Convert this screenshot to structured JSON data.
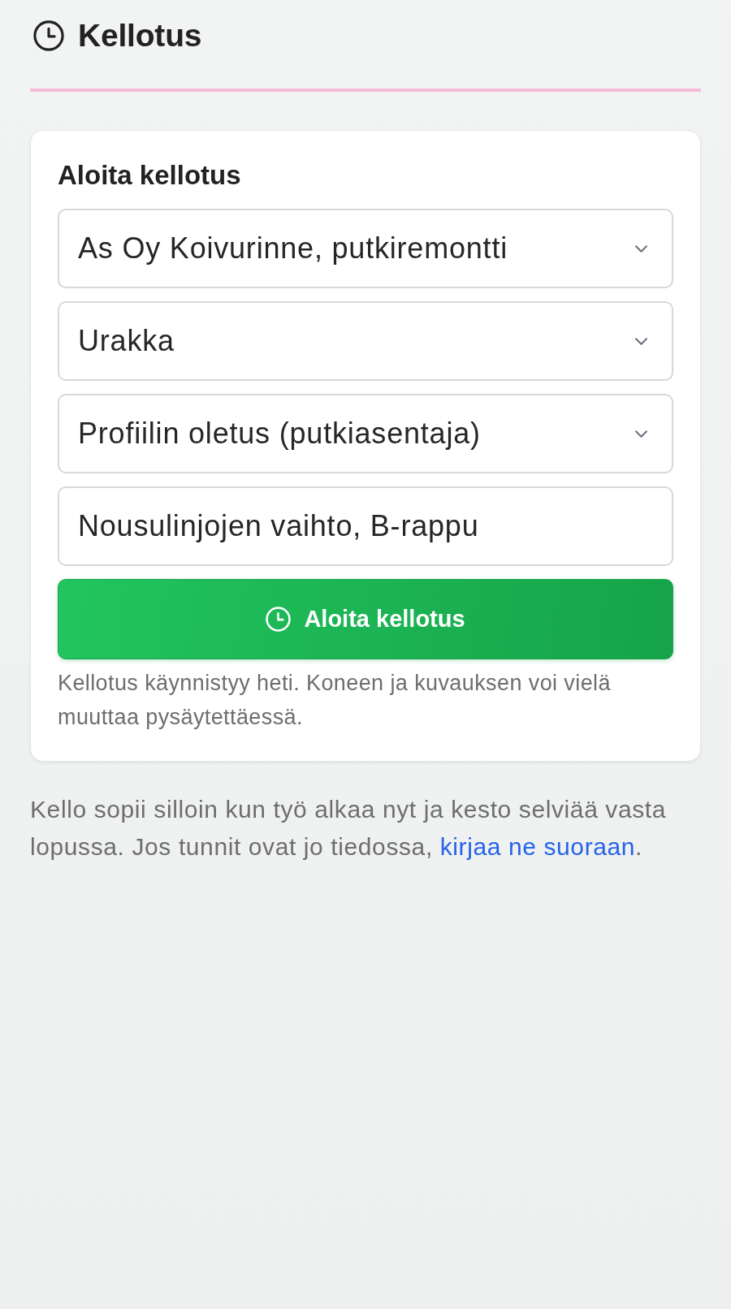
{
  "header": {
    "title": "Kellotus"
  },
  "card": {
    "heading": "Aloita kellotus",
    "fields": [
      {
        "kind": "select",
        "value": "As Oy Koivurinne, putkiremontti"
      },
      {
        "kind": "select",
        "value": "Urakka"
      },
      {
        "kind": "select",
        "value": "Profiilin oletus (putkiasentaja)"
      },
      {
        "kind": "text",
        "value": "Nousulinjojen vaihto, B-rappu"
      }
    ],
    "button": {
      "label": "Aloita kellotus"
    },
    "hint": "Kellotus käynnistyy heti. Koneen ja kuvauksen voi vielä muuttaa pysäytettäessä."
  },
  "footer": {
    "text": "Kello sopii silloin kun työ alkaa nyt ja kesto selviää vasta lopussa. Jos tunnit ovat jo tiedossa, ",
    "link": "kirjaa ne suoraan",
    "after": "."
  }
}
